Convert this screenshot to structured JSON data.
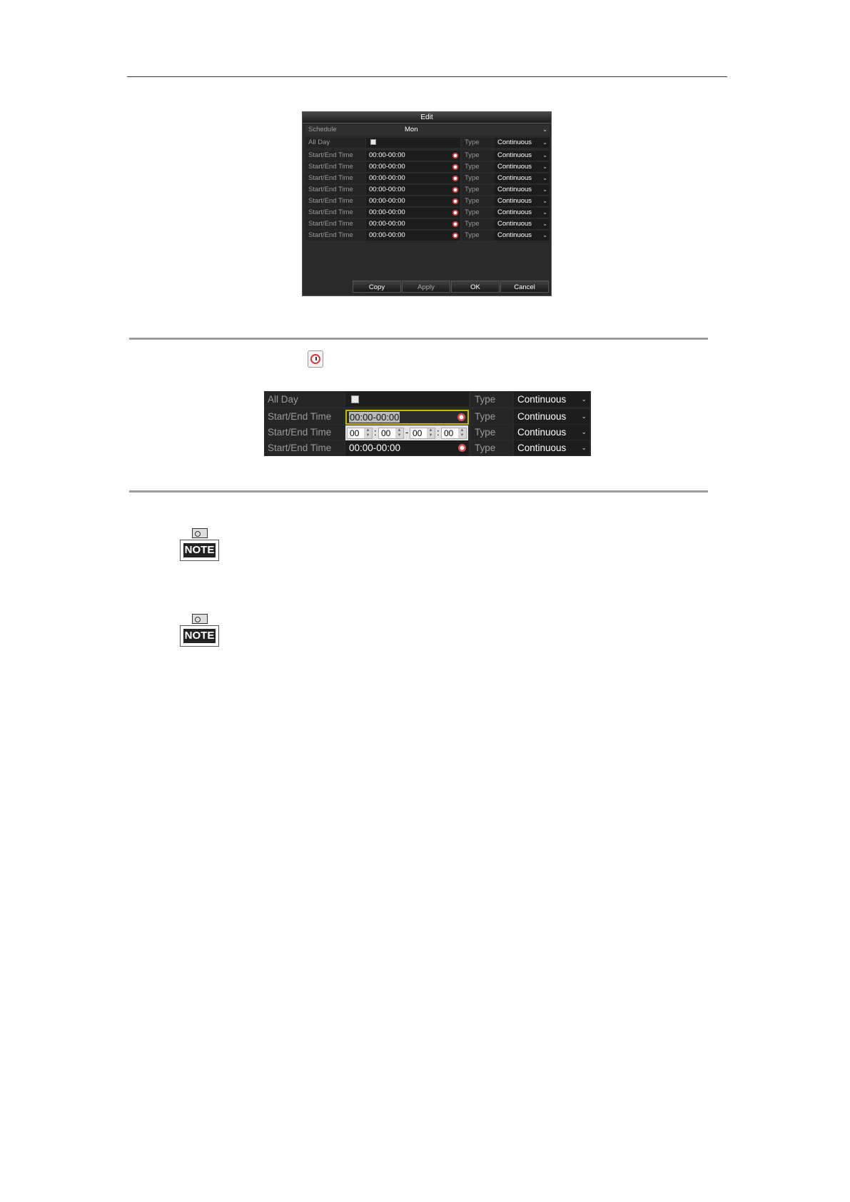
{
  "dialog": {
    "title": "Edit",
    "schedule_label": "Schedule",
    "schedule_value": "Mon",
    "all_day_label": "All Day",
    "type_label": "Type",
    "type_value": "Continuous",
    "rows": [
      {
        "label": "Start/End Time",
        "time": "00:00-00:00",
        "type_label": "Type",
        "type_value": "Continuous"
      },
      {
        "label": "Start/End Time",
        "time": "00:00-00:00",
        "type_label": "Type",
        "type_value": "Continuous"
      },
      {
        "label": "Start/End Time",
        "time": "00:00-00:00",
        "type_label": "Type",
        "type_value": "Continuous"
      },
      {
        "label": "Start/End Time",
        "time": "00:00-00:00",
        "type_label": "Type",
        "type_value": "Continuous"
      },
      {
        "label": "Start/End Time",
        "time": "00:00-00:00",
        "type_label": "Type",
        "type_value": "Continuous"
      },
      {
        "label": "Start/End Time",
        "time": "00:00-00:00",
        "type_label": "Type",
        "type_value": "Continuous"
      },
      {
        "label": "Start/End Time",
        "time": "00:00-00:00",
        "type_label": "Type",
        "type_value": "Continuous"
      },
      {
        "label": "Start/End Time",
        "time": "00:00-00:00",
        "type_label": "Type",
        "type_value": "Continuous"
      }
    ],
    "buttons": {
      "copy": "Copy",
      "apply": "Apply",
      "ok": "OK",
      "cancel": "Cancel"
    }
  },
  "zoom": {
    "all_day_label": "All Day",
    "type_label": "Type",
    "type_value": "Continuous",
    "row1": {
      "label": "Start/End Time",
      "time": "00:00-00:00",
      "type_label": "Type",
      "type_value": "Continuous"
    },
    "row2": {
      "label": "Start/End Time",
      "type_label": "Type",
      "type_value": "Continuous",
      "start_hour": "00",
      "start_min": "00",
      "end_hour": "00",
      "end_min": "00",
      "colon": ":",
      "dash": "-"
    },
    "row3": {
      "label": "Start/End Time",
      "time": "00:00-00:00",
      "type_label": "Type",
      "type_value": "Continuous"
    }
  },
  "notes": [
    "NOTE",
    "NOTE"
  ],
  "icons": {
    "clock": "clock-icon",
    "dropdown": "chevron-down-icon",
    "note": "note-icon"
  },
  "colors": {
    "panel_bg": "#2a2a2a",
    "highlight": "#c8b800",
    "clock_red": "#d8504f"
  }
}
